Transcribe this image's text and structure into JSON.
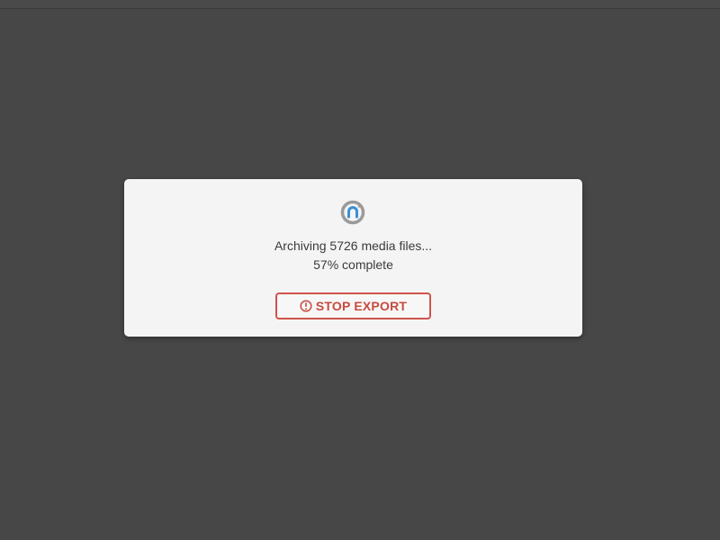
{
  "dialog": {
    "status_line": "Archiving 5726 media files...",
    "progress_line": "57% complete",
    "progress_percent": 57,
    "stop_button_label": "STOP EXPORT"
  },
  "icons": {
    "spinner": "sync-spinner-icon",
    "stop": "alert-circle-icon"
  },
  "colors": {
    "backdrop": "#474747",
    "dialog_bg": "#f4f4f4",
    "danger": "#d0534a",
    "spinner_blue": "#3b8fd6",
    "spinner_gray": "#9a9a9a"
  }
}
